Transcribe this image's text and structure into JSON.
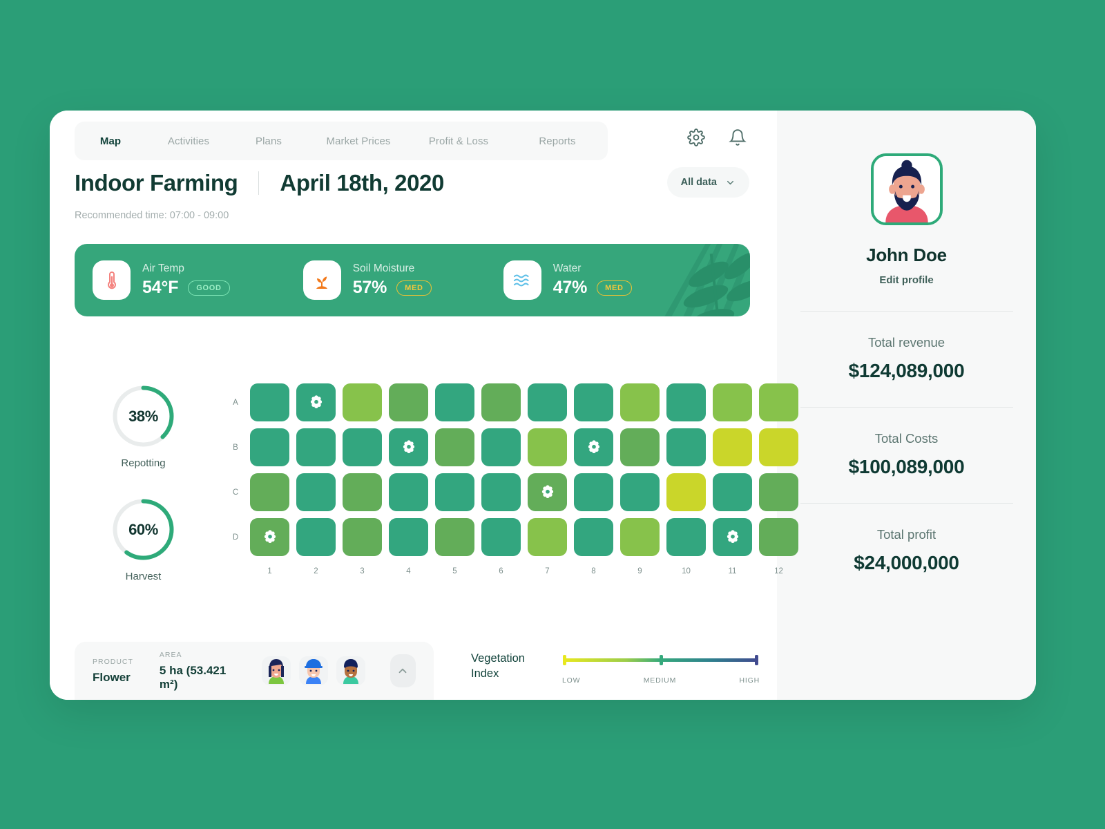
{
  "nav": {
    "tabs": [
      {
        "label": "Map",
        "active": true
      },
      {
        "label": "Activities",
        "active": false
      },
      {
        "label": "Plans",
        "active": false
      },
      {
        "label": "Market Prices",
        "active": false
      },
      {
        "label": "Profit & Loss",
        "active": false
      },
      {
        "label": "Reports",
        "active": false
      }
    ],
    "icons": [
      "gear-icon",
      "bell-icon"
    ]
  },
  "header": {
    "title": "Indoor Farming",
    "date": "April 18th, 2020",
    "recommended_time": "Recommended time: 07:00 - 09:00",
    "filter_label": "All data"
  },
  "stats": [
    {
      "name": "Air Temp",
      "value": "54°F",
      "badge": "GOOD",
      "badge_type": "good",
      "icon": "thermometer-icon",
      "icon_color": "#f4837f"
    },
    {
      "name": "Soil Moisture",
      "value": "57%",
      "badge": "MED",
      "badge_type": "med",
      "icon": "seedling-icon",
      "icon_color": "#f2791b"
    },
    {
      "name": "Water",
      "value": "47%",
      "badge": "MED",
      "badge_type": "med",
      "icon": "water-waves-icon",
      "icon_color": "#5fc0e8"
    }
  ],
  "rings": [
    {
      "percent": 38,
      "label": "Repotting",
      "display": "38%"
    },
    {
      "percent": 60,
      "label": "Harvest",
      "display": "60%"
    }
  ],
  "chart_data": {
    "type": "heatmap",
    "title": "Field vegetation map",
    "row_labels": [
      "A",
      "B",
      "C",
      "D"
    ],
    "col_labels": [
      "1",
      "2",
      "3",
      "4",
      "5",
      "6",
      "7",
      "8",
      "9",
      "10",
      "11",
      "12"
    ],
    "legend": {
      "title_line1": "Vegetation",
      "title_line2": "Index",
      "ticks": [
        "LOW",
        "MEDIUM",
        "HIGH"
      ],
      "gradient": [
        "#e8e81f",
        "#9ccd4a",
        "#35a97c",
        "#2f7f8e",
        "#414a8f"
      ]
    },
    "palette": {
      "teal": "#33a67f",
      "mid": "#63ad59",
      "light": "#87c24b",
      "yellow": "#cad62a"
    },
    "cells": [
      [
        {
          "v": "teal",
          "flower": false
        },
        {
          "v": "teal",
          "flower": true
        },
        {
          "v": "light",
          "flower": false
        },
        {
          "v": "mid",
          "flower": false
        },
        {
          "v": "teal",
          "flower": false
        },
        {
          "v": "mid",
          "flower": false
        },
        {
          "v": "teal",
          "flower": false
        },
        {
          "v": "teal",
          "flower": false
        },
        {
          "v": "light",
          "flower": false
        },
        {
          "v": "teal",
          "flower": false
        },
        {
          "v": "light",
          "flower": false
        },
        {
          "v": "light",
          "flower": false
        }
      ],
      [
        {
          "v": "teal",
          "flower": false
        },
        {
          "v": "teal",
          "flower": false
        },
        {
          "v": "teal",
          "flower": false
        },
        {
          "v": "teal",
          "flower": true
        },
        {
          "v": "mid",
          "flower": false
        },
        {
          "v": "teal",
          "flower": false
        },
        {
          "v": "light",
          "flower": false
        },
        {
          "v": "teal",
          "flower": true
        },
        {
          "v": "mid",
          "flower": false
        },
        {
          "v": "teal",
          "flower": false
        },
        {
          "v": "yellow",
          "flower": false
        },
        {
          "v": "yellow",
          "flower": false
        }
      ],
      [
        {
          "v": "mid",
          "flower": false
        },
        {
          "v": "teal",
          "flower": false
        },
        {
          "v": "mid",
          "flower": false
        },
        {
          "v": "teal",
          "flower": false
        },
        {
          "v": "teal",
          "flower": false
        },
        {
          "v": "teal",
          "flower": false
        },
        {
          "v": "mid",
          "flower": true
        },
        {
          "v": "teal",
          "flower": false
        },
        {
          "v": "teal",
          "flower": false
        },
        {
          "v": "yellow",
          "flower": false
        },
        {
          "v": "teal",
          "flower": false
        },
        {
          "v": "mid",
          "flower": false
        }
      ],
      [
        {
          "v": "mid",
          "flower": true
        },
        {
          "v": "teal",
          "flower": false
        },
        {
          "v": "mid",
          "flower": false
        },
        {
          "v": "teal",
          "flower": false
        },
        {
          "v": "mid",
          "flower": false
        },
        {
          "v": "teal",
          "flower": false
        },
        {
          "v": "light",
          "flower": false
        },
        {
          "v": "teal",
          "flower": false
        },
        {
          "v": "light",
          "flower": false
        },
        {
          "v": "teal",
          "flower": false
        },
        {
          "v": "teal",
          "flower": true
        },
        {
          "v": "mid",
          "flower": false
        }
      ]
    ]
  },
  "footer": {
    "product_caption": "PRODUCT",
    "product_value": "Flower",
    "area_caption": "AREA",
    "area_value": "5 ha (53.421 m²)",
    "collapse_icon": "chevron-up-icon",
    "workers": [
      "worker-avatar-1",
      "worker-avatar-2",
      "worker-avatar-3"
    ]
  },
  "sidebar": {
    "user_name": "John Doe",
    "edit_profile": "Edit profile",
    "avatar": "user-avatar",
    "finances": [
      {
        "label": "Total revenue",
        "value": "$124,089,000"
      },
      {
        "label": "Total Costs",
        "value": "$100,089,000"
      },
      {
        "label": "Total profit",
        "value": "$24,000,000"
      }
    ]
  },
  "theme": {
    "background": "#2b9e77",
    "accent": "#2eaa79",
    "dark_text": "#11423a"
  }
}
